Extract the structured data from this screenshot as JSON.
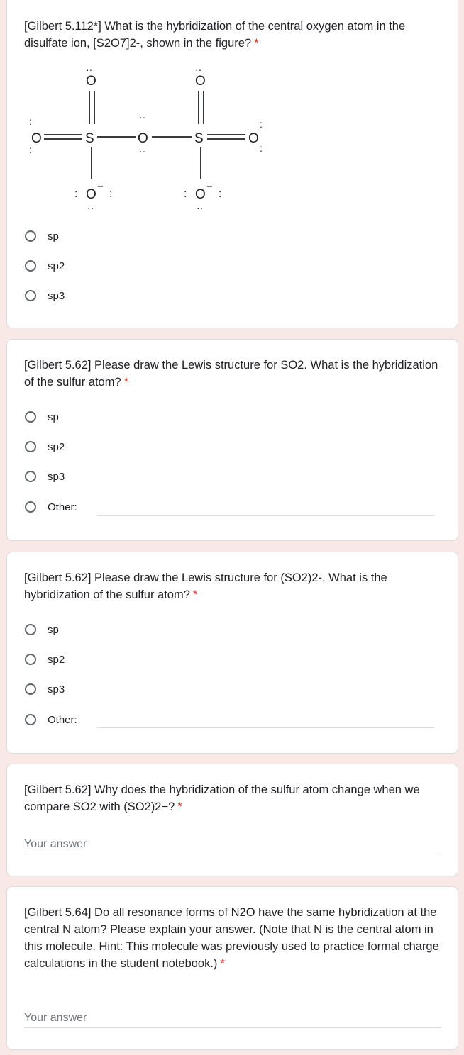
{
  "questions": [
    {
      "title": "[Gilbert 5.112*] What is the hybridization of the central oxygen atom in the disulfate ion, [S2O7]2-, shown in the figure?",
      "required_mark": "*",
      "options": [
        "sp",
        "sp2",
        "sp3"
      ]
    },
    {
      "title": "[Gilbert 5.62] Please draw the Lewis structure for SO2. What is the hybridization of the sulfur atom?",
      "required_mark": "*",
      "options": [
        "sp",
        "sp2",
        "sp3",
        "Other:"
      ]
    },
    {
      "title": "[Gilbert 5.62] Please draw the Lewis structure for (SO2)2-. What is the hybridization of the sulfur atom?",
      "required_mark": "*",
      "options": [
        "sp",
        "sp2",
        "sp3",
        "Other:"
      ]
    },
    {
      "title": "[Gilbert 5.62] Why does the hybridization of the sulfur atom change when we compare SO2 with (SO2)2−?",
      "required_mark": "*",
      "answer_placeholder": "Your answer"
    },
    {
      "title": "[Gilbert 5.64] Do all resonance forms of N2O have the same hybridization at the central N atom? Please explain your answer. (Note that N is the central atom in this molecule. Hint: This molecule was previously used to practice formal charge calculations in the student notebook.)",
      "required_mark": "*",
      "answer_placeholder": "Your answer"
    }
  ],
  "figure": {
    "atoms": {
      "O_left": "O",
      "S_left": "S",
      "O_bridge": "O",
      "S_right": "S",
      "O_right": "O",
      "O_top_left": "O",
      "O_top_right": "O",
      "O_bottom_left": "O",
      "O_bottom_right": "O"
    },
    "charge": "−",
    "lone_pair": "··",
    "lone_pair_vertical": ":"
  },
  "colors": {
    "background": "#f8e8e6",
    "required": "#d93025",
    "radio_border": "#5f6368",
    "divider": "#dadce0"
  }
}
